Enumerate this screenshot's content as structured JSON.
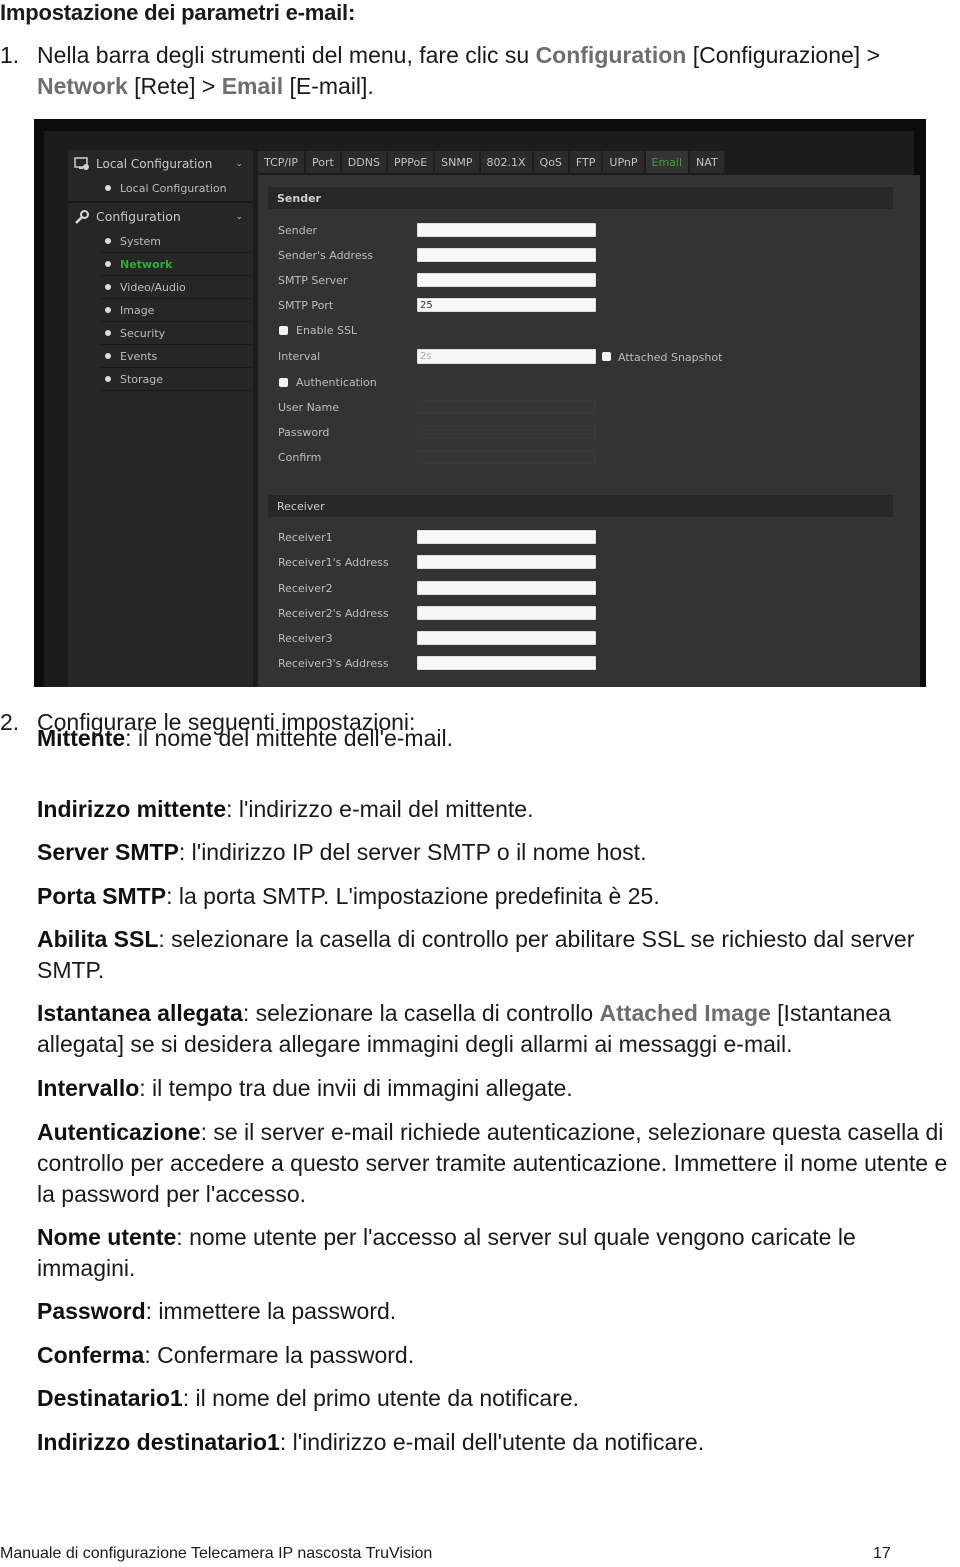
{
  "doc": {
    "title": "Impostazione dei parametri e-mail:",
    "step1": {
      "num": "1.",
      "text_a": "Nella barra degli strumenti del menu, fare clic su ",
      "hl_configuration": "Configuration",
      "text_b": " [Configurazione] >",
      "hl_network": "Network",
      "text_c": " [Rete] > ",
      "hl_email": "Email",
      "text_d": " [E-mail]."
    },
    "step2": {
      "num": "2.",
      "text": "Configurare le seguenti impostazioni:"
    },
    "definitions": [
      {
        "term": "Mittente",
        "desc": ": il nome del mittente dell'e-mail."
      },
      {
        "term": "Indirizzo mittente",
        "desc": ": l'indirizzo e-mail del mittente."
      },
      {
        "term": "Server SMTP",
        "desc": ": l'indirizzo IP del server SMTP o il nome host."
      },
      {
        "term": "Porta SMTP",
        "desc": ": la porta SMTP. L'impostazione predefinita è 25."
      },
      {
        "term": "Abilita SSL",
        "desc": ": selezionare la casella di controllo per abilitare SSL se richiesto dal server SMTP."
      },
      {
        "term": "Istantanea allegata",
        "desc_a": ": selezionare la casella di controllo ",
        "hl": "Attached Image",
        "desc_b": " [Istantanea allegata] se si desidera allegare immagini degli allarmi ai messaggi e-mail."
      },
      {
        "term": "Intervallo",
        "desc": ": il tempo tra due invii di immagini allegate."
      },
      {
        "term": "Autenticazione",
        "desc": ": se il server e-mail richiede autenticazione, selezionare questa casella di controllo per accedere a questo server tramite autenticazione. Immettere il nome utente e la password per l'accesso."
      },
      {
        "term": "Nome utente",
        "desc": ": nome utente per l'accesso al server sul quale vengono caricate le immagini."
      },
      {
        "term": "Password",
        "desc": ": immettere la password."
      },
      {
        "term": "Conferma",
        "desc": ": Confermare la password."
      },
      {
        "term": "Destinatario1",
        "desc": ": il nome del primo utente da notificare."
      },
      {
        "term": "Indirizzo destinatario1",
        "desc": ": l'indirizzo e-mail dell'utente da notificare."
      }
    ],
    "footer": "Manuale di configurazione Telecamera IP nascosta TruVision",
    "page_number": "17"
  },
  "ui": {
    "sidebar": {
      "local_config_header": "Local Configuration",
      "local_config_items": [
        "Local Configuration"
      ],
      "config_header": "Configuration",
      "config_items": [
        "System",
        "Network",
        "Video/Audio",
        "Image",
        "Security",
        "Events",
        "Storage"
      ],
      "active_item": "Network"
    },
    "tabs": [
      "TCP/IP",
      "Port",
      "DDNS",
      "PPPoE",
      "SNMP",
      "802.1X",
      "QoS",
      "FTP",
      "UPnP",
      "Email",
      "NAT"
    ],
    "active_tab": "Email",
    "sender_section": {
      "title": "Sender",
      "sender_label": "Sender",
      "sender_value": "",
      "address_label": "Sender's Address",
      "address_value": "",
      "smtp_server_label": "SMTP Server",
      "smtp_server_value": "",
      "smtp_port_label": "SMTP Port",
      "smtp_port_value": "25",
      "enable_ssl_label": "Enable SSL",
      "enable_ssl_checked": false,
      "interval_label": "Interval",
      "interval_value": "2s",
      "attached_snapshot_label": "Attached Snapshot",
      "attached_snapshot_checked": false,
      "authentication_label": "Authentication",
      "authentication_checked": false,
      "username_label": "User Name",
      "password_label": "Password",
      "confirm_label": "Confirm"
    },
    "receiver_section": {
      "title": "Receiver",
      "fields": [
        {
          "label": "Receiver1",
          "value": ""
        },
        {
          "label": "Receiver1's Address",
          "value": ""
        },
        {
          "label": "Receiver2",
          "value": ""
        },
        {
          "label": "Receiver2's Address",
          "value": ""
        },
        {
          "label": "Receiver3",
          "value": ""
        },
        {
          "label": "Receiver3's Address",
          "value": ""
        }
      ]
    },
    "colors": {
      "active_green": "#2fae2f",
      "panel_bg": "#333333",
      "highlight_gray": "#6e6e6e"
    }
  }
}
